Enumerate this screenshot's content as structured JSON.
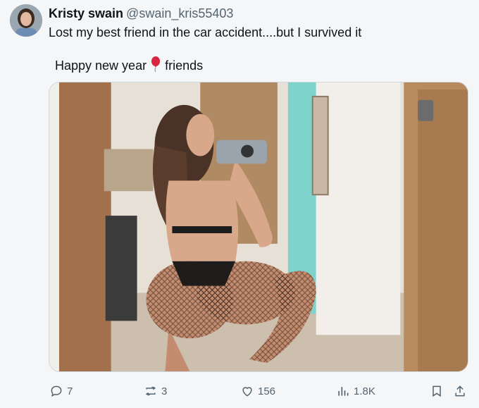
{
  "author": {
    "display_name": "Kristy swain",
    "handle": "@swain_kris55403"
  },
  "tweet": {
    "line1": "Lost my best friend in the car accident....but I survived it",
    "line2_before": "Happy new year",
    "line2_after": "friends"
  },
  "stats": {
    "replies": "7",
    "reposts": "3",
    "likes": "156",
    "views": "1.8K"
  },
  "icons": {
    "reply": "reply-icon",
    "repost": "repost-icon",
    "like": "heart-icon",
    "views": "views-icon",
    "bookmark": "bookmark-icon",
    "share": "share-icon",
    "emoji": "balloon-icon"
  },
  "colors": {
    "balloon": "#d7263d",
    "secondary_text": "#536471",
    "primary_text": "#0f1419"
  }
}
